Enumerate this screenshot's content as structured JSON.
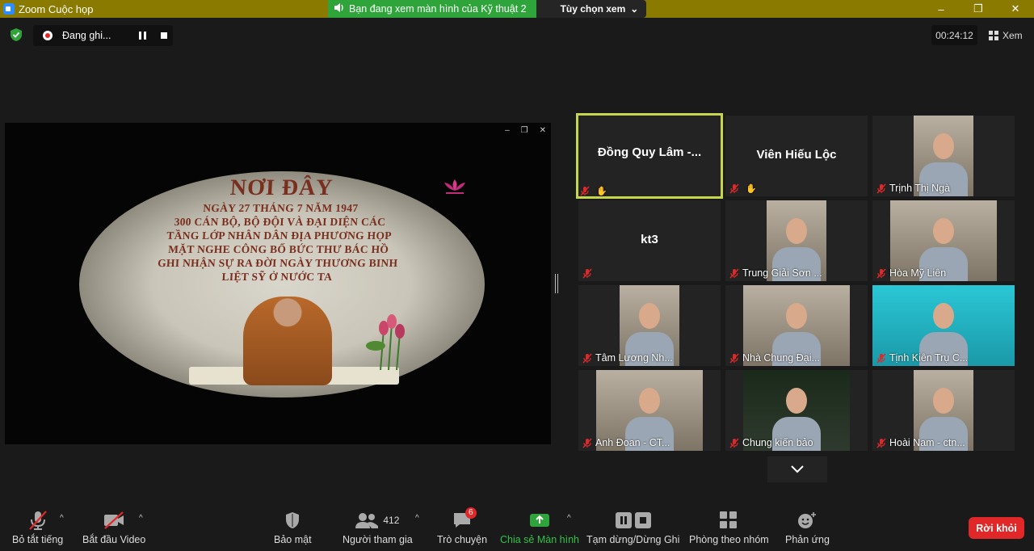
{
  "window": {
    "title": "Zoom Cuộc họp",
    "viewing_banner": "Bạn đang xem màn hình của Kỹ thuật 2",
    "view_options": "Tùy chọn xem",
    "controls": {
      "minimize": "–",
      "restore": "❐",
      "close": "✕"
    }
  },
  "recording": {
    "status": "Đang ghi..."
  },
  "timer": "00:24:12",
  "view_label": "Xem",
  "shared_screen": {
    "heading": "NƠI ĐÂY",
    "lines": [
      "NGÀY 27 THÁNG 7 NĂM 1947",
      "300 CÁN BỘ, BỘ ĐỘI VÀ ĐẠI DIỆN CÁC",
      "TẦNG LỚP NHÂN DÂN ĐỊA PHƯƠNG HỌP",
      "MẶT NGHE CÔNG BỐ BỨC THƯ BÁC HỒ",
      "GHI NHẬN SỰ RA ĐỜI NGÀY THƯƠNG BINH",
      "LIỆT SỸ Ở NƯỚC TA"
    ]
  },
  "participants": [
    {
      "name": "Đồng Quy Lâm -...",
      "label": "Đồng Quy Lâm -...",
      "video": false,
      "pinned": true,
      "active": true
    },
    {
      "name": "Viên Hiếu Lộc",
      "label": "Viên Hiếu Lộc",
      "video": false,
      "pinned": true,
      "active": false
    },
    {
      "name": "Trịnh Thị Ngà",
      "video": true
    },
    {
      "name": "kt3",
      "label": "kt3",
      "video": false
    },
    {
      "name": "Trung Giải Sơn ...",
      "video": true
    },
    {
      "name": "Hòa Mỹ Liên",
      "video": true
    },
    {
      "name": "Tâm Lương Nh...",
      "video": true
    },
    {
      "name": "Nhà Chung Đại...",
      "video": true
    },
    {
      "name": "Tịnh Kiên Trụ C...",
      "video": true
    },
    {
      "name": "Anh Đoan - CT...",
      "video": true
    },
    {
      "name": "Chung kiến bảo",
      "video": true
    },
    {
      "name": "Hoài Nam - ctn...",
      "video": true
    }
  ],
  "toolbar": {
    "mute": "Bỏ tắt tiếng",
    "video": "Bắt đầu Video",
    "security": "Bảo mật",
    "participants": "Người tham gia",
    "participants_count": "412",
    "chat": "Trò chuyện",
    "chat_badge": "6",
    "share": "Chia sẻ Màn hình",
    "pause_record": "Tạm dừng/Dừng Ghi",
    "breakout": "Phòng theo nhóm",
    "reactions": "Phản ứng",
    "leave": "Rời khỏi"
  },
  "colors": {
    "active_speaker": "#c6d64b",
    "share_green": "#2ea43b",
    "leave_red": "#e02828",
    "titlebar": "#8a7a00"
  }
}
